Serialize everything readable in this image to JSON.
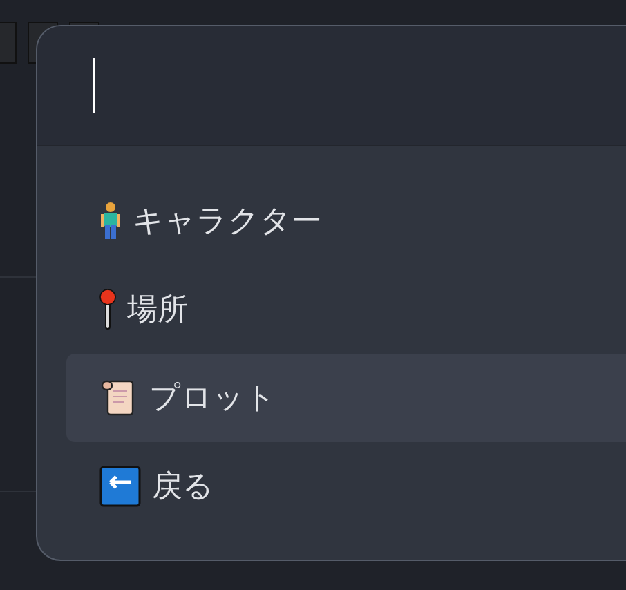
{
  "menu": {
    "items": [
      {
        "label": "キャラクター",
        "selected": false
      },
      {
        "label": "場所",
        "selected": false
      },
      {
        "label": "プロット",
        "selected": true
      },
      {
        "label": "戻る",
        "selected": false
      }
    ]
  }
}
